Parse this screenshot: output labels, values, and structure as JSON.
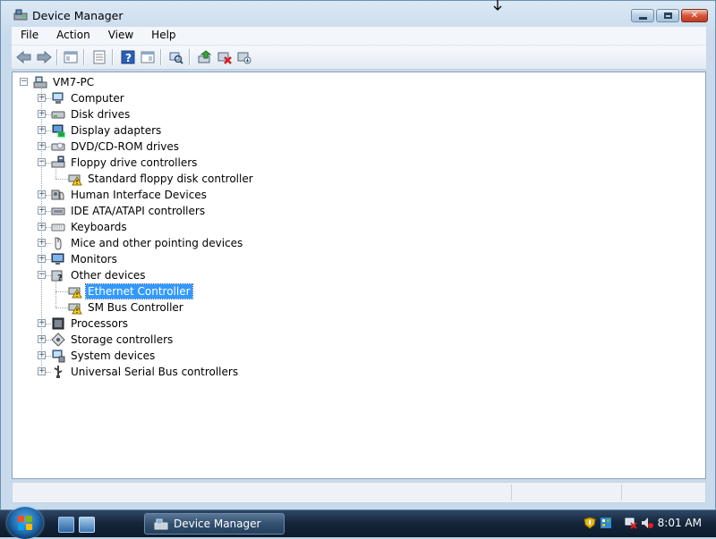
{
  "window": {
    "title": "Device Manager",
    "caption": {
      "min": "–",
      "max": "□",
      "close": "✕"
    }
  },
  "menu": [
    {
      "label": "File"
    },
    {
      "label": "Action"
    },
    {
      "label": "View"
    },
    {
      "label": "Help"
    }
  ],
  "toolbar": [
    {
      "icon": "back-arrow-icon"
    },
    {
      "icon": "forward-arrow-icon"
    },
    {
      "icon": "show-hide-console-tree-icon"
    },
    {
      "icon": "properties-icon"
    },
    {
      "icon": "help-icon"
    },
    {
      "icon": "show-hide-action-pane-icon"
    },
    {
      "icon": "scan-hardware-changes-icon"
    },
    {
      "icon": "update-driver-icon"
    },
    {
      "icon": "disable-device-icon"
    },
    {
      "icon": "uninstall-device-icon"
    }
  ],
  "tree": {
    "root": "VM7-PC",
    "nodes": [
      {
        "label": "Computer",
        "icon": "computer-icon",
        "state": "collapsed"
      },
      {
        "label": "Disk drives",
        "icon": "disk-drive-icon",
        "state": "collapsed"
      },
      {
        "label": "Display adapters",
        "icon": "display-adapter-icon",
        "state": "collapsed"
      },
      {
        "label": "DVD/CD-ROM drives",
        "icon": "dvd-drive-icon",
        "state": "collapsed"
      },
      {
        "label": "Floppy drive controllers",
        "icon": "floppy-controller-icon",
        "state": "expanded",
        "children": [
          {
            "label": "Standard floppy disk controller",
            "icon": "warning-device-icon"
          }
        ]
      },
      {
        "label": "Human Interface Devices",
        "icon": "hid-icon",
        "state": "collapsed"
      },
      {
        "label": "IDE ATA/ATAPI controllers",
        "icon": "ide-controller-icon",
        "state": "collapsed"
      },
      {
        "label": "Keyboards",
        "icon": "keyboard-icon",
        "state": "collapsed"
      },
      {
        "label": "Mice and other pointing devices",
        "icon": "mouse-icon",
        "state": "collapsed"
      },
      {
        "label": "Monitors",
        "icon": "monitor-icon",
        "state": "collapsed"
      },
      {
        "label": "Other devices",
        "icon": "unknown-device-icon",
        "state": "expanded",
        "children": [
          {
            "label": "Ethernet Controller",
            "icon": "warning-device-icon",
            "selected": true
          },
          {
            "label": "SM Bus Controller",
            "icon": "warning-device-icon"
          }
        ]
      },
      {
        "label": "Processors",
        "icon": "processor-icon",
        "state": "collapsed"
      },
      {
        "label": "Storage controllers",
        "icon": "storage-controller-icon",
        "state": "collapsed"
      },
      {
        "label": "System devices",
        "icon": "system-device-icon",
        "state": "collapsed"
      },
      {
        "label": "Universal Serial Bus controllers",
        "icon": "usb-icon",
        "state": "collapsed"
      }
    ]
  },
  "taskbar": {
    "task_button": "Device Manager",
    "clock": "8:01 AM"
  },
  "colors": {
    "selection": "#3399ff",
    "window_frame": "#c8daec",
    "taskbar": "#16263c"
  }
}
